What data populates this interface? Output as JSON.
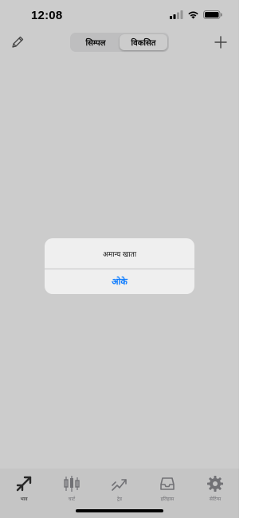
{
  "status_bar": {
    "time": "12:08",
    "icons": [
      "cellular-signal-icon",
      "wifi-icon",
      "battery-icon"
    ]
  },
  "nav": {
    "left_icon": "pencil-icon",
    "right_icon": "plus-icon",
    "segments": [
      {
        "label": "सिम्पल",
        "selected": false
      },
      {
        "label": "विकसित",
        "selected": true
      }
    ]
  },
  "tabs": [
    {
      "label": "भाव",
      "icon": "quotes-arrow-icon",
      "active": true
    },
    {
      "label": "चार्ट",
      "icon": "candlestick-chart-icon",
      "active": false
    },
    {
      "label": "ट्रेड",
      "icon": "trade-trend-icon",
      "active": false
    },
    {
      "label": "इतिहास",
      "icon": "inbox-history-icon",
      "active": false
    },
    {
      "label": "सेटिंग्स",
      "icon": "gear-icon",
      "active": false
    }
  ],
  "alert": {
    "message": "अमान्य खाता",
    "button": "ओके"
  },
  "colors": {
    "accent": "#0a7aff",
    "tab_inactive": "#8e8e93",
    "overlay": "rgba(0,0,0,0.2)"
  }
}
